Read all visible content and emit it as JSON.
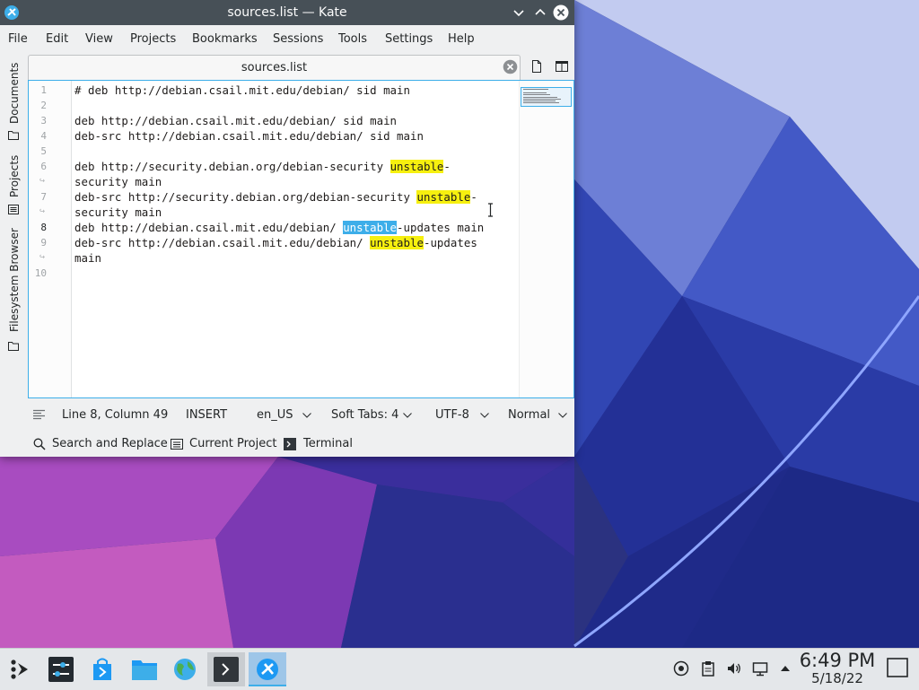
{
  "window": {
    "title": "sources.list — Kate",
    "menu": [
      "File",
      "Edit",
      "View",
      "Projects",
      "Bookmarks",
      "Sessions",
      "Tools",
      "Settings",
      "Help"
    ]
  },
  "side_panel": {
    "tabs": [
      "Documents",
      "Projects",
      "Filesystem Browser"
    ]
  },
  "tab": {
    "title": "sources.list"
  },
  "editor": {
    "rows": [
      {
        "n": "1",
        "parts": [
          {
            "t": "# deb http://debian.csail.mit.edu/debian/ sid main"
          }
        ]
      },
      {
        "n": "2",
        "parts": []
      },
      {
        "n": "3",
        "parts": [
          {
            "t": "deb http://debian.csail.mit.edu/debian/ sid main"
          }
        ]
      },
      {
        "n": "4",
        "parts": [
          {
            "t": "deb-src http://debian.csail.mit.edu/debian/ sid main"
          }
        ]
      },
      {
        "n": "5",
        "parts": []
      },
      {
        "n": "6",
        "parts": [
          {
            "t": "deb http://security.debian.org/debian-security "
          },
          {
            "t": "unstable",
            "hl": true
          },
          {
            "t": "-"
          }
        ]
      },
      {
        "n": "",
        "wrap": true,
        "parts": [
          {
            "t": "security main"
          }
        ]
      },
      {
        "n": "7",
        "parts": [
          {
            "t": "deb-src http://security.debian.org/debian-security "
          },
          {
            "t": "unstable",
            "hl": true
          },
          {
            "t": "-"
          }
        ]
      },
      {
        "n": "",
        "wrap": true,
        "parts": [
          {
            "t": "security main"
          }
        ]
      },
      {
        "n": "8",
        "current": true,
        "parts": [
          {
            "t": "deb http://debian.csail.mit.edu/debian/ "
          },
          {
            "t": "unstable",
            "sel": true
          },
          {
            "t": "-updates main"
          }
        ]
      },
      {
        "n": "9",
        "parts": [
          {
            "t": "deb-src http://debian.csail.mit.edu/debian/ "
          },
          {
            "t": "unstable",
            "hl": true
          },
          {
            "t": "-updates"
          }
        ]
      },
      {
        "n": "",
        "wrap": true,
        "parts": [
          {
            "t": "main"
          }
        ]
      },
      {
        "n": "10",
        "parts": []
      }
    ]
  },
  "status": {
    "position": "Line 8, Column 49",
    "mode": "INSERT",
    "dictionary": "en_US",
    "indent": "Soft Tabs: 4",
    "encoding": "UTF-8",
    "highlight": "Normal"
  },
  "bottom_tools": {
    "search": "Search and Replace",
    "project": "Current Project",
    "terminal": "Terminal"
  },
  "clock": {
    "time": "6:49 PM",
    "date": "5/18/22"
  },
  "colors": {
    "titlebar": "#475057",
    "accent": "#3daee9",
    "search_highlight": "#f6f00f",
    "panel": "#eff0f1",
    "taskbar": "#e4e7ea"
  }
}
